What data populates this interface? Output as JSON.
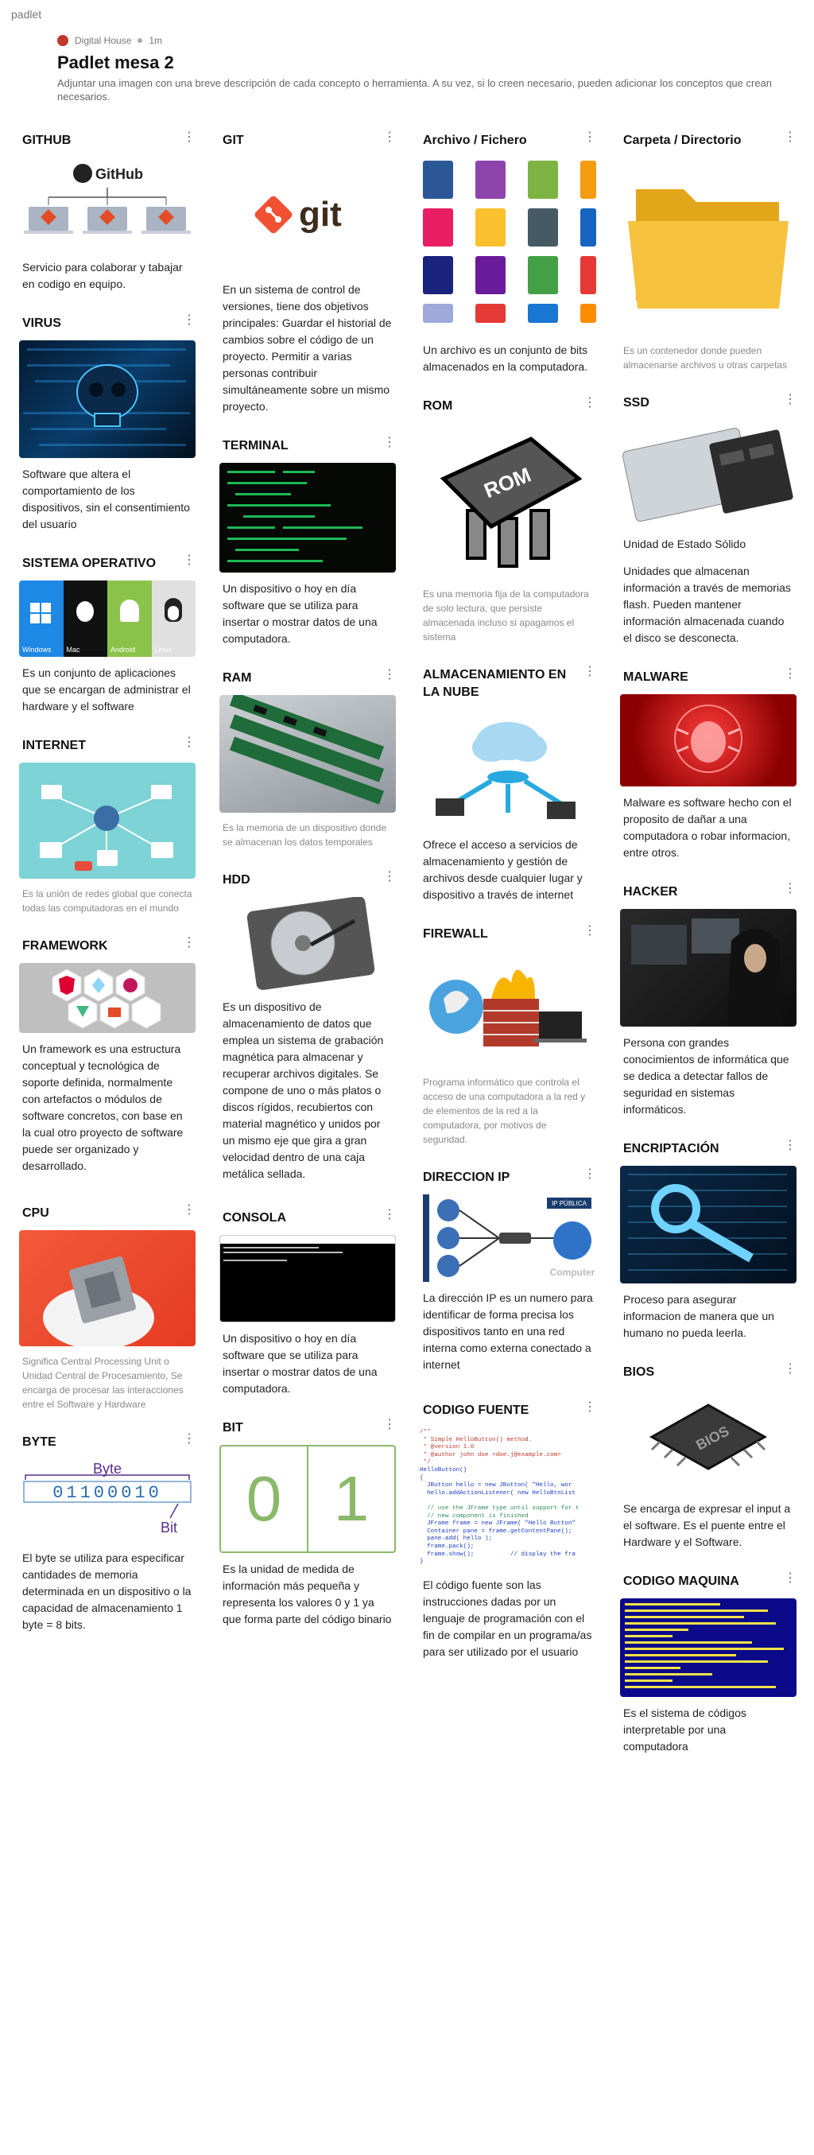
{
  "app": {
    "brand": "padlet"
  },
  "header": {
    "author": "Digital House",
    "time": "1m",
    "title": "Padlet mesa 2",
    "description": "Adjuntar una imagen con una breve descripción de cada concepto o herramienta. A su vez, si lo creen necesario, pueden adicionar los conceptos que crean necesarios."
  },
  "columns": {
    "col1": [
      {
        "title": "GITHUB",
        "body": "Servicio para colaborar y tabajar en codigo en equipo."
      },
      {
        "title": "VIRUS",
        "body": "Software que altera el comportamiento de los dispositivos, sin el consentimiento del usuario"
      },
      {
        "title": "SISTEMA OPERATIVO",
        "body": "Es un conjunto de aplicaciones que se encargan de administrar el hardware y el software"
      },
      {
        "title": "INTERNET",
        "body": "Es la unión de redes global que conecta todas las computadoras en el mundo"
      },
      {
        "title": "FRAMEWORK",
        "body": "Un framework es una estructura conceptual y tecnológica de soporte definida, normalmente con artefactos o módulos de software concretos, con base en la cual otro proyecto de software puede ser organizado y desarrollado."
      },
      {
        "title": "CPU",
        "body": "Significa Central Processing Unit o Unidad Central de Procesamiento, Se encarga de procesar las interacciones entre el Software y Hardware"
      },
      {
        "title": "BYTE",
        "body": "El byte se utiliza para especificar cantidades de memoria determinada en un dispositivo o la capacidad de almacenamiento 1 byte = 8 bits."
      }
    ],
    "col2": [
      {
        "title": "GIT",
        "body": "En un sistema de control de versiones, tiene dos objetivos principales: Guardar el historial de cambios sobre el código de un proyecto. Permitir a varias personas contribuir simultáneamente sobre un mismo proyecto."
      },
      {
        "title": "TERMINAL",
        "body": "Un dispositivo o hoy en día software que se utiliza para insertar o mostrar datos de una computadora."
      },
      {
        "title": "RAM",
        "body": "Es la memoria de un dispositivo donde se almacenan los datos temporales"
      },
      {
        "title": "HDD",
        "body": "Es un dispositivo de almacenamiento de datos que emplea un sistema de grabación magnética para almacenar y recuperar archivos digitales. Se compone de uno o más platos o discos rígidos, recubiertos con material magnético y unidos por un mismo eje que gira a gran velocidad dentro de una caja metálica sellada."
      },
      {
        "title": "CONSOLA",
        "body": "Un dispositivo o hoy en día software que se utiliza para insertar o mostrar datos de una computadora."
      },
      {
        "title": "BIT",
        "body": "Es la unidad de medida de información más pequeña y representa los valores 0 y 1 ya que forma parte del código binario"
      }
    ],
    "col3": [
      {
        "title": "Archivo / Fichero",
        "body": "Un archivo es un conjunto de bits almacenados en la computadora."
      },
      {
        "title": "ROM",
        "body": "Es una memoria fija de la computadora de solo lectura, que persiste almacenada incluso si apagamos el sistema"
      },
      {
        "title": "ALMACENAMIENTO EN LA NUBE",
        "body": "Ofrece el acceso a servicios de almacenamiento y gestión de archivos desde cualquier lugar y dispositivo a través de internet"
      },
      {
        "title": "FIREWALL",
        "body": "Programa informático que controla el acceso de una computadora a la red y de elementos de la red a la computadora, por motivos de seguridad."
      },
      {
        "title": "DIRECCION IP",
        "body": "La dirección IP es un numero para identificar de forma precisa los dispositivos tanto en una red interna como externa conectado a internet"
      },
      {
        "title": "CODIGO FUENTE",
        "body": "El código fuente son las instrucciones dadas por un lenguaje de programación con el fin de compilar en un programa/as  para ser utilizado por el usuario"
      }
    ],
    "col4": [
      {
        "title": "Carpeta / Directorio",
        "body": "Es un contenedor donde pueden almacenarse archivos u otras carpetas"
      },
      {
        "title": "SSD",
        "subtitle": "Unidad de Estado Sólido",
        "body": "Unidades que almacenan información a través de memorias flash. Pueden mantener información almacenada cuando el disco se desconecta."
      },
      {
        "title": "MALWARE",
        "body": "Malware es software hecho con el proposito de dañar a una computadora o robar informacion, entre otros."
      },
      {
        "title": "HACKER",
        "body": "Persona con grandes conocimientos de informática que se dedica a detectar fallos de seguridad en sistemas informáticos."
      },
      {
        "title": "ENCRIPTACIÓN",
        "body": "Proceso para asegurar informacion de manera que un humano no pueda leerla."
      },
      {
        "title": "BIOS",
        "body": "Se encarga de expresar el input a el software. Es el puente entre el Hardware y el Software."
      },
      {
        "title": "CODIGO MAQUINA",
        "body": "Es el sistema de códigos interpretable por una computadora"
      }
    ]
  },
  "image_text": {
    "github_logo": "GitHub",
    "git_logo": "git",
    "os_labels": [
      "Windows",
      "Mac",
      "Android",
      "Linux"
    ],
    "rom_chip": "ROM",
    "bios_chip": "BIOS",
    "byte_label": "Byte",
    "byte_bits": "01100010",
    "bit_label": "Bit",
    "bit_zero": "0",
    "bit_one": "1",
    "ip_label": "IP PÚBLICA",
    "cloud_label": "Computer",
    "code_snippet": [
      "/**",
      " * Simple HelloButton() method.",
      " * @version 1.0",
      " * @author john doe <doe.j@example.com>",
      " */",
      "HelloButton()",
      "{",
      "  JButton hello = new JButton( \"Hello, wor",
      "  hello.addActionListener( new HelloBtnList",
      "",
      "  // use the JFrame type until support for t",
      "  // new component is finished",
      "  JFrame frame = new JFrame( \"Hello Button\"",
      "  Container pane = frame.getContentPane();",
      "  pane.add( hello );",
      "  frame.pack();",
      "  frame.show();          // display the fra",
      "}"
    ]
  },
  "colors": {
    "accent_red": "#e34c26",
    "github_blue": "#2b6cb0",
    "malware_red": "#d62828",
    "encrypt_blue": "#1a4a7a",
    "terminal_green": "#1db954"
  }
}
